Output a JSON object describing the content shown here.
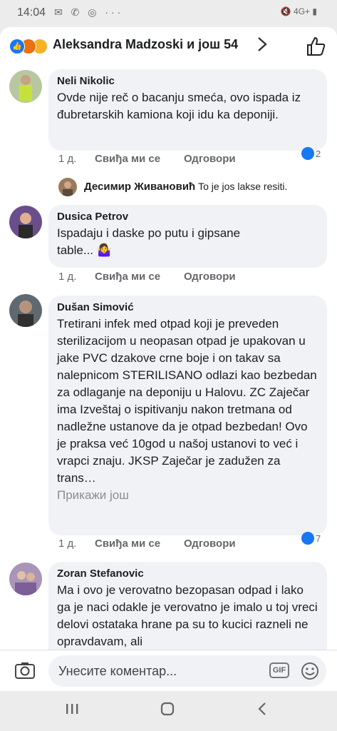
{
  "status_bar": {
    "time": "14:04",
    "signal_text": "4G+"
  },
  "header": {
    "title": "Aleksandra Madzoski и још 54"
  },
  "comments": [
    {
      "name": "Neli Nikolic",
      "text": "Ovde nije reč o bacanju smeća, ovo ispada iz đubretarskih kamiona koji idu ka deponiji.",
      "time": "1 д.",
      "like_label": "Свиђа ми се",
      "reply_label": "Одговори",
      "reaction_count": "2",
      "reply": {
        "name": "Десимир Живановић",
        "text": "To je jos lakse resiti."
      }
    },
    {
      "name": "Dusica Petrov",
      "text": "Ispadaju i daske po putu i gipsane table... 🤷‍♀️",
      "time": "1 д.",
      "like_label": "Свиђа ми се",
      "reply_label": "Одговори"
    },
    {
      "name": "Dušan Simović",
      "text": "Tretirani infek med otpad koji je preveden sterilizacijom u neopasan otpad je upakovan u jake PVC dzakove crne boje i on takav sa nalepnicom STERILISANO odlazi kao bezbedan za odlaganje na deponiju u Halovu. ZC Zaječar ima Izveštaj o ispitivanju nakon tretmana od nadležne ustanove da je otpad bezbedan! Ovo je praksa već 10god u našoj ustanovi to već i vrapci znaju. JKSP Zaječar je zadužen za trans…",
      "see_more": "Прикажи још",
      "time": "1 д.",
      "like_label": "Свиђа ми се",
      "reply_label": "Одговори",
      "reaction_count": "7"
    },
    {
      "name": "Zoran Stefanovic",
      "text": "Ma i ovo je verovatno bezopasan odpad i lako ga je naci odakle je  verovatno je imalo u toj vreci delovi ostataka hrane pa su to kucici razneli ne opravdavam, ali"
    }
  ],
  "composer": {
    "placeholder": "Унесите коментар...",
    "gif_label": "GIF"
  },
  "colors": {
    "facebook_blue": "#1877f2",
    "bubble_bg": "#f0f2f5",
    "secondary_text": "#65676b"
  }
}
